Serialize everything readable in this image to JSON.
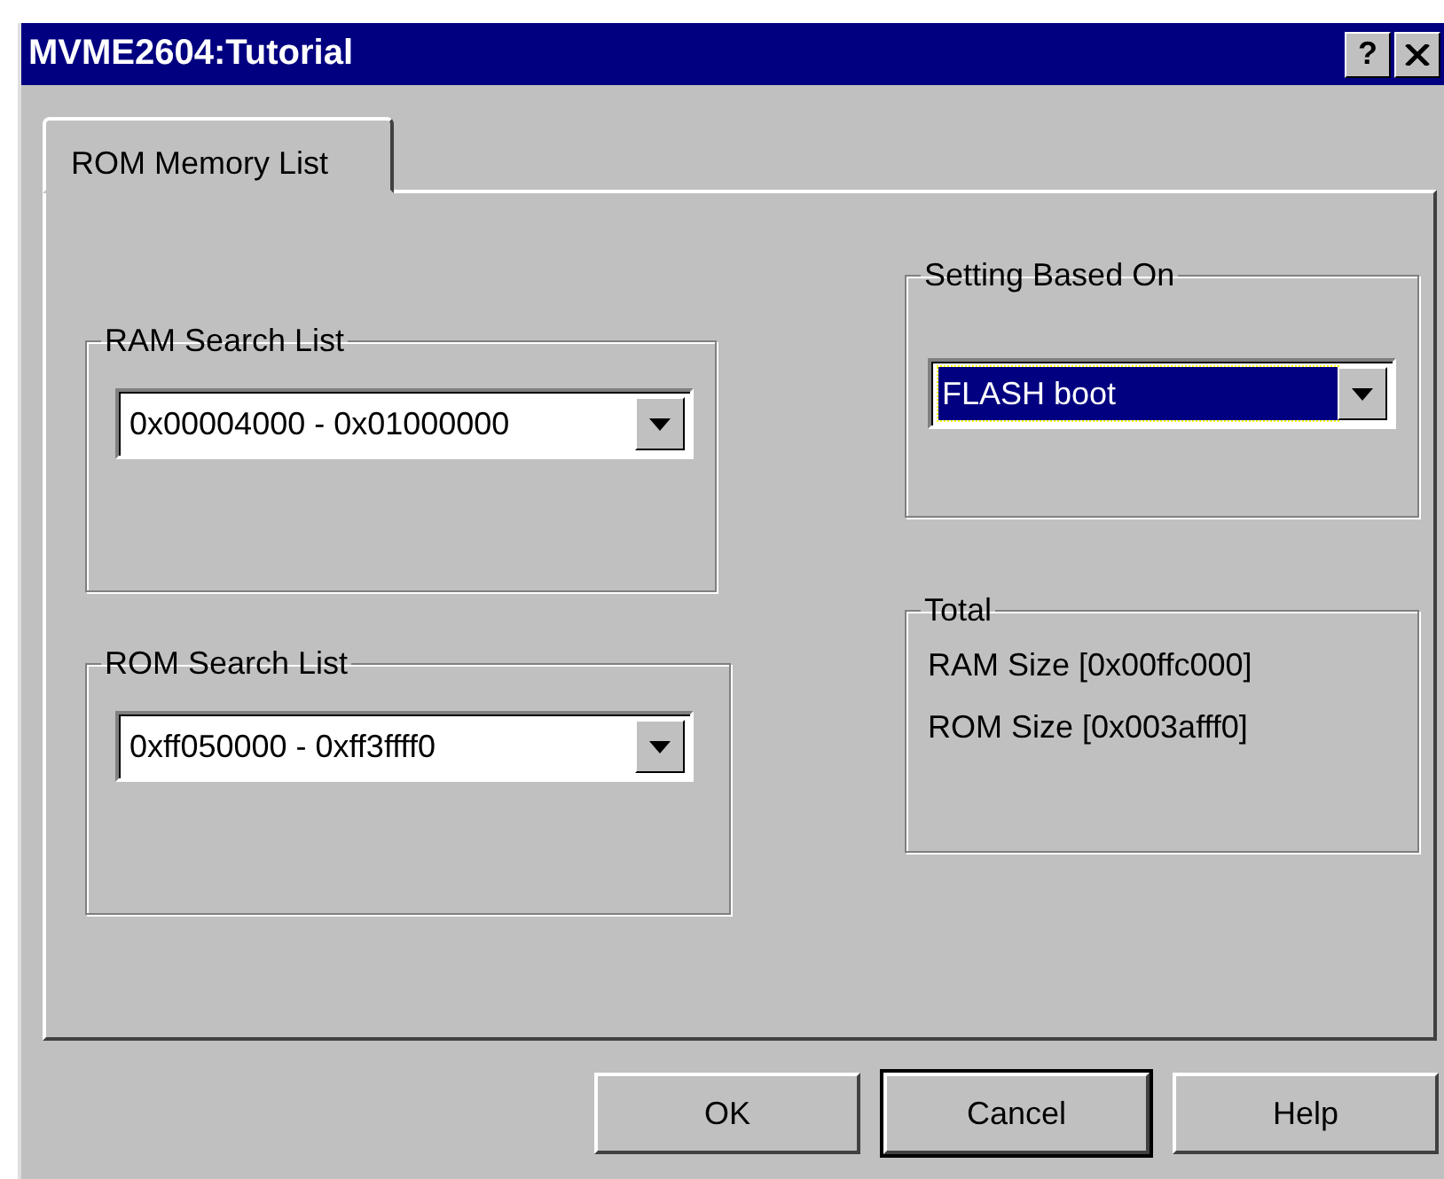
{
  "window": {
    "title": "MVME2604:Tutorial",
    "help_button": "?"
  },
  "tabs": [
    {
      "label": "ROM Memory List",
      "selected": true
    }
  ],
  "left_groups": [
    {
      "title": "RAM Search List",
      "combo": {
        "value": "0x00004000 - 0x01000000",
        "highlighted": false
      }
    },
    {
      "title": "ROM Search List",
      "combo": {
        "value": "0xff050000 - 0xff3ffff0",
        "highlighted": false
      }
    }
  ],
  "setting_group": {
    "title": "Setting Based On",
    "combo": {
      "value": "FLASH boot",
      "highlighted": true
    }
  },
  "total_group": {
    "title": "Total",
    "lines": [
      "RAM Size [0x00ffc000]",
      "ROM Size [0x003afff0]"
    ]
  },
  "buttons": [
    {
      "label": "OK",
      "default": false
    },
    {
      "label": "Cancel",
      "default": true
    },
    {
      "label": "Help",
      "default": false
    }
  ]
}
